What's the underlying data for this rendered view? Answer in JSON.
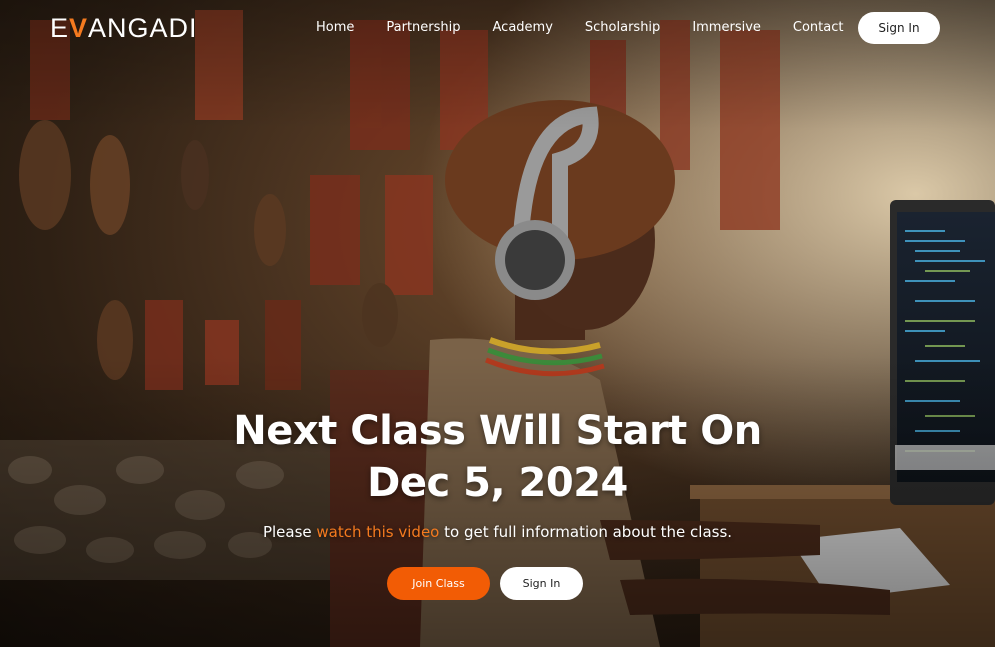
{
  "brand": {
    "logo_prefix": "E",
    "logo_accent": "V",
    "logo_suffix": "ANGADI",
    "accent_color": "#f47a1f"
  },
  "nav": {
    "links": [
      "Home",
      "Partnership",
      "Academy",
      "Scholarship",
      "Immersive",
      "Contact"
    ],
    "signin_label": "Sign In"
  },
  "hero": {
    "headline_line1": "Next Class Will Start On",
    "headline_line2": "Dec 5, 2024",
    "subtitle_before": "Please ",
    "subtitle_link": "watch this video",
    "subtitle_after": " to get full information about the class.",
    "join_label": "Join Class",
    "signin_label": "Sign In",
    "join_color": "#f25c05"
  },
  "background": {
    "icon": "hero-photo-boy-with-headphones-at-computer"
  }
}
